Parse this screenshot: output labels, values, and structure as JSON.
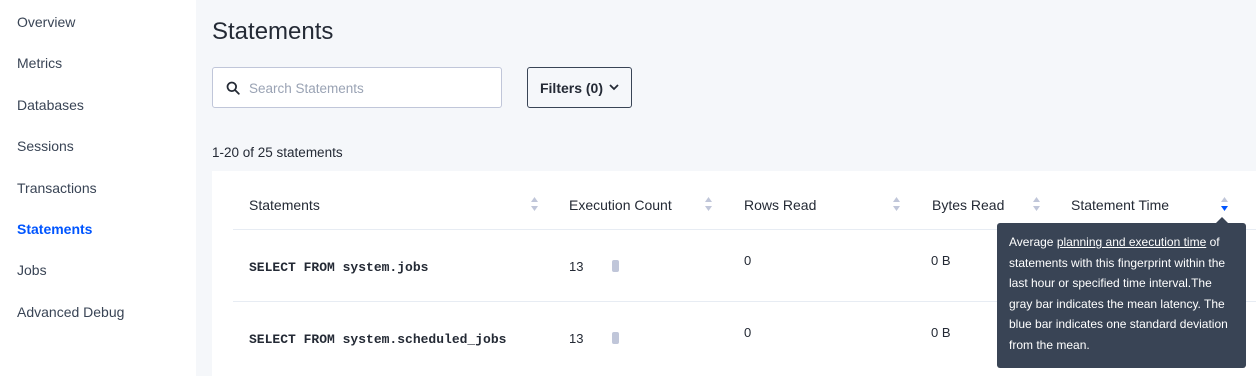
{
  "sidebar": {
    "items": [
      {
        "label": "Overview"
      },
      {
        "label": "Metrics"
      },
      {
        "label": "Databases"
      },
      {
        "label": "Sessions"
      },
      {
        "label": "Transactions"
      },
      {
        "label": "Statements",
        "active": true
      },
      {
        "label": "Jobs"
      },
      {
        "label": "Advanced Debug"
      }
    ]
  },
  "page": {
    "title": "Statements",
    "search_placeholder": "Search Statements",
    "filters_label": "Filters (0)",
    "count_text": "1-20 of 25 statements"
  },
  "table": {
    "columns": [
      "Statements",
      "Execution Count",
      "Rows Read",
      "Bytes Read",
      "Statement Time"
    ],
    "rows": [
      {
        "statement": "SELECT FROM system.jobs",
        "execution_count": "13",
        "rows_read": "0",
        "bytes_read": "0 B"
      },
      {
        "statement": "SELECT FROM system.scheduled_jobs",
        "execution_count": "13",
        "rows_read": "0",
        "bytes_read": "0 B"
      }
    ]
  },
  "tooltip": {
    "prefix": "Average ",
    "link": "planning and execution time",
    "suffix": " of statements with this fingerprint within the last hour or specified time interval.The gray bar indicates the mean latency. The blue bar indicates one standard deviation from the mean."
  },
  "colors": {
    "accent": "#0055ff",
    "tooltip_bg": "#394455",
    "page_bg": "#f5f7fa"
  }
}
